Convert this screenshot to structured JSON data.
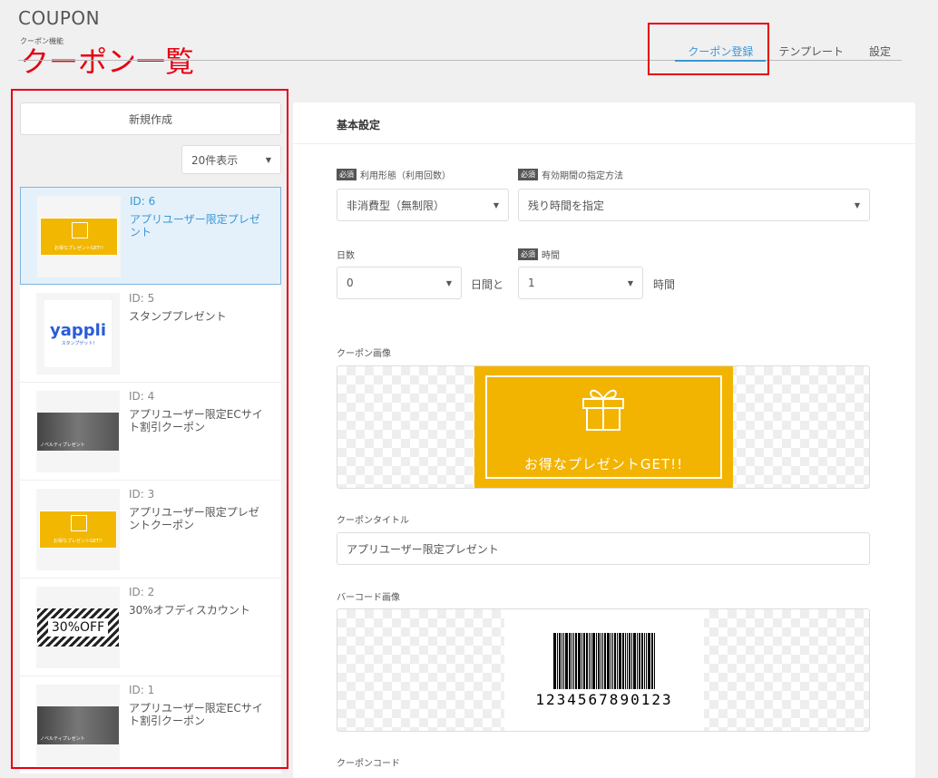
{
  "header": {
    "app_title": "COUPON",
    "breadcrumb": "クーポン機能",
    "page_title": "クーポン一覧"
  },
  "tabs": [
    {
      "label": "クーポン登録",
      "active": true
    },
    {
      "label": "テンプレート",
      "active": false
    },
    {
      "label": "設定",
      "active": false
    }
  ],
  "sidebar": {
    "new_button": "新規作成",
    "per_page": "20件表示",
    "coupons": [
      {
        "id": "ID: 6",
        "name": "アプリユーザー限定プレゼント",
        "thumb": "gift",
        "thumb_text": "お得なプレゼントGET!!"
      },
      {
        "id": "ID: 5",
        "name": "スタンププレゼント",
        "thumb": "yappli",
        "thumb_text": "yappli",
        "thumb_sub": "スタンプゲット!"
      },
      {
        "id": "ID: 4",
        "name": "アプリユーザー限定ECサイト割引クーポン",
        "thumb": "photo",
        "thumb_text": "ノベルティプレゼント"
      },
      {
        "id": "ID: 3",
        "name": "アプリユーザー限定プレゼントクーポン",
        "thumb": "gift",
        "thumb_text": "お得なプレゼントGET!!"
      },
      {
        "id": "ID: 2",
        "name": "30%オフディスカウント",
        "thumb": "off",
        "thumb_text": "30%OFF"
      },
      {
        "id": "ID: 1",
        "name": "アプリユーザー限定ECサイト割引クーポン",
        "thumb": "photo",
        "thumb_text": "ノベルティプレゼント"
      }
    ]
  },
  "main": {
    "section_title": "基本設定",
    "required_badge": "必須",
    "usage_label": "利用形態（利用回数）",
    "usage_value": "非消費型（無制限）",
    "validity_label": "有効期間の指定方法",
    "validity_value": "残り時間を指定",
    "days_label": "日数",
    "days_value": "0",
    "days_unit": "日間と",
    "hours_label": "時間",
    "hours_value": "1",
    "hours_unit": "時間",
    "image_label": "クーポン画像",
    "banner_text": "お得なプレゼントGET!!",
    "coupon_title_label": "クーポンタイトル",
    "coupon_title_value": "アプリユーザー限定プレゼント",
    "barcode_label": "バーコード画像",
    "barcode_number": "1234567890123",
    "coupon_code_label": "クーポンコード"
  },
  "colors": {
    "accent": "#3b96d6",
    "annotation": "#e60012",
    "coupon_yellow": "#f2b400"
  }
}
